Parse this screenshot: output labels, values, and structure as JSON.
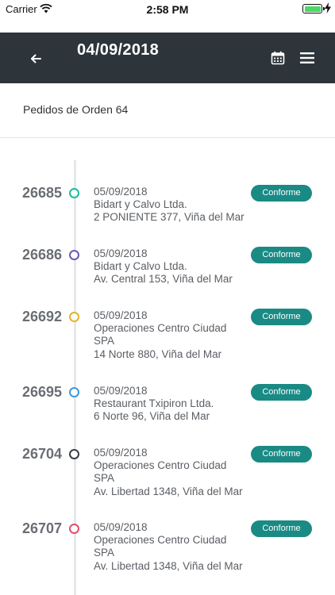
{
  "status_bar": {
    "carrier": "Carrier",
    "time": "2:58 PM"
  },
  "header": {
    "title": "04/09/2018",
    "back_icon": "arrow-left-icon",
    "calendar_icon": "calendar-icon",
    "menu_icon": "hamburger-menu-icon",
    "background_color": "#2d353b"
  },
  "section": {
    "title": "Pedidos de Orden 64"
  },
  "colors": {
    "badge": "#1a8a84"
  },
  "orders": [
    {
      "id": "26685",
      "date": "05/09/2018",
      "name": "Bidart y Calvo Ltda.",
      "address": "2 PONIENTE 377, Viña del Mar",
      "status": "Conforme",
      "dot_color": "#1abc9c"
    },
    {
      "id": "26686",
      "date": "05/09/2018",
      "name": "Bidart y Calvo Ltda.",
      "address": "Av. Central 153, Viña del Mar",
      "status": "Conforme",
      "dot_color": "#6c5ab8"
    },
    {
      "id": "26692",
      "date": "05/09/2018",
      "name": "Operaciones Centro Ciudad SPA",
      "address": "14 Norte 880, Viña del Mar",
      "status": "Conforme",
      "dot_color": "#e5b42b"
    },
    {
      "id": "26695",
      "date": "05/09/2018",
      "name": "Restaurant Txipiron Ltda.",
      "address": "6 Norte 96, Viña del Mar",
      "status": "Conforme",
      "dot_color": "#3b9ae1"
    },
    {
      "id": "26704",
      "date": "05/09/2018",
      "name": "Operaciones Centro Ciudad SPA",
      "address": "Av. Libertad 1348, Viña del Mar",
      "status": "Conforme",
      "dot_color": "#3a3f45"
    },
    {
      "id": "26707",
      "date": "05/09/2018",
      "name": "Operaciones Centro Ciudad SPA",
      "address": "Av. Libertad 1348, Viña del Mar",
      "status": "Conforme",
      "dot_color": "#e2506a"
    }
  ]
}
